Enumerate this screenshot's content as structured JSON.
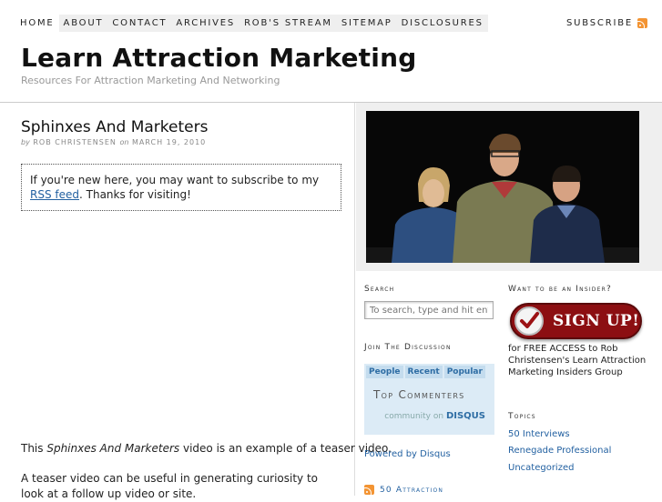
{
  "nav": {
    "items": [
      "Home",
      "About",
      "Contact",
      "Archives",
      "Rob's Stream",
      "Sitemap",
      "Disclosures"
    ],
    "subscribe": "Subscribe"
  },
  "header": {
    "title": "Learn Attraction Marketing",
    "tagline": "Resources For Attraction Marketing And Networking"
  },
  "post": {
    "title": "Sphinxes And Marketers",
    "by": "by",
    "author": "Rob Christensen",
    "on": "on",
    "date": "March 19, 2010",
    "notice_before": "If you're new here, you may want to subscribe to my ",
    "notice_link": "RSS feed",
    "notice_after": ". Thanks for visiting!",
    "p1_before": "This ",
    "p1_em": "Sphinxes And Marketers",
    "p1_after": " video is an example of a teaser video.",
    "p2": "A teaser video can be useful in generating curiosity to look at a follow up video or site."
  },
  "sidebar": {
    "search_heading": "Search",
    "search_placeholder": "To search, type and hit enter",
    "discussion_heading": "Join The Discussion",
    "disqus_tabs": [
      "People",
      "Recent",
      "Popular"
    ],
    "disqus_top": "Top Commenters",
    "disqus_foot": "community on",
    "disqus_brand": "DISQUS",
    "powered": "Powered by Disqus",
    "bottom_heading": "50 Attraction",
    "insider_heading": "Want to be an Insider?",
    "signup_label": "SIGN UP!",
    "insider_text": "for FREE ACCESS to Rob Christensen's Learn Attraction Marketing Insiders Group",
    "topics_heading": "Topics",
    "topics": [
      "50 Interviews",
      "Renegade Professional",
      "Uncategorized"
    ]
  },
  "colors": {
    "link": "#2361a1",
    "rss": "#f39433",
    "signup": "#8c0f12",
    "disqus_bg": "#dcebf6"
  }
}
